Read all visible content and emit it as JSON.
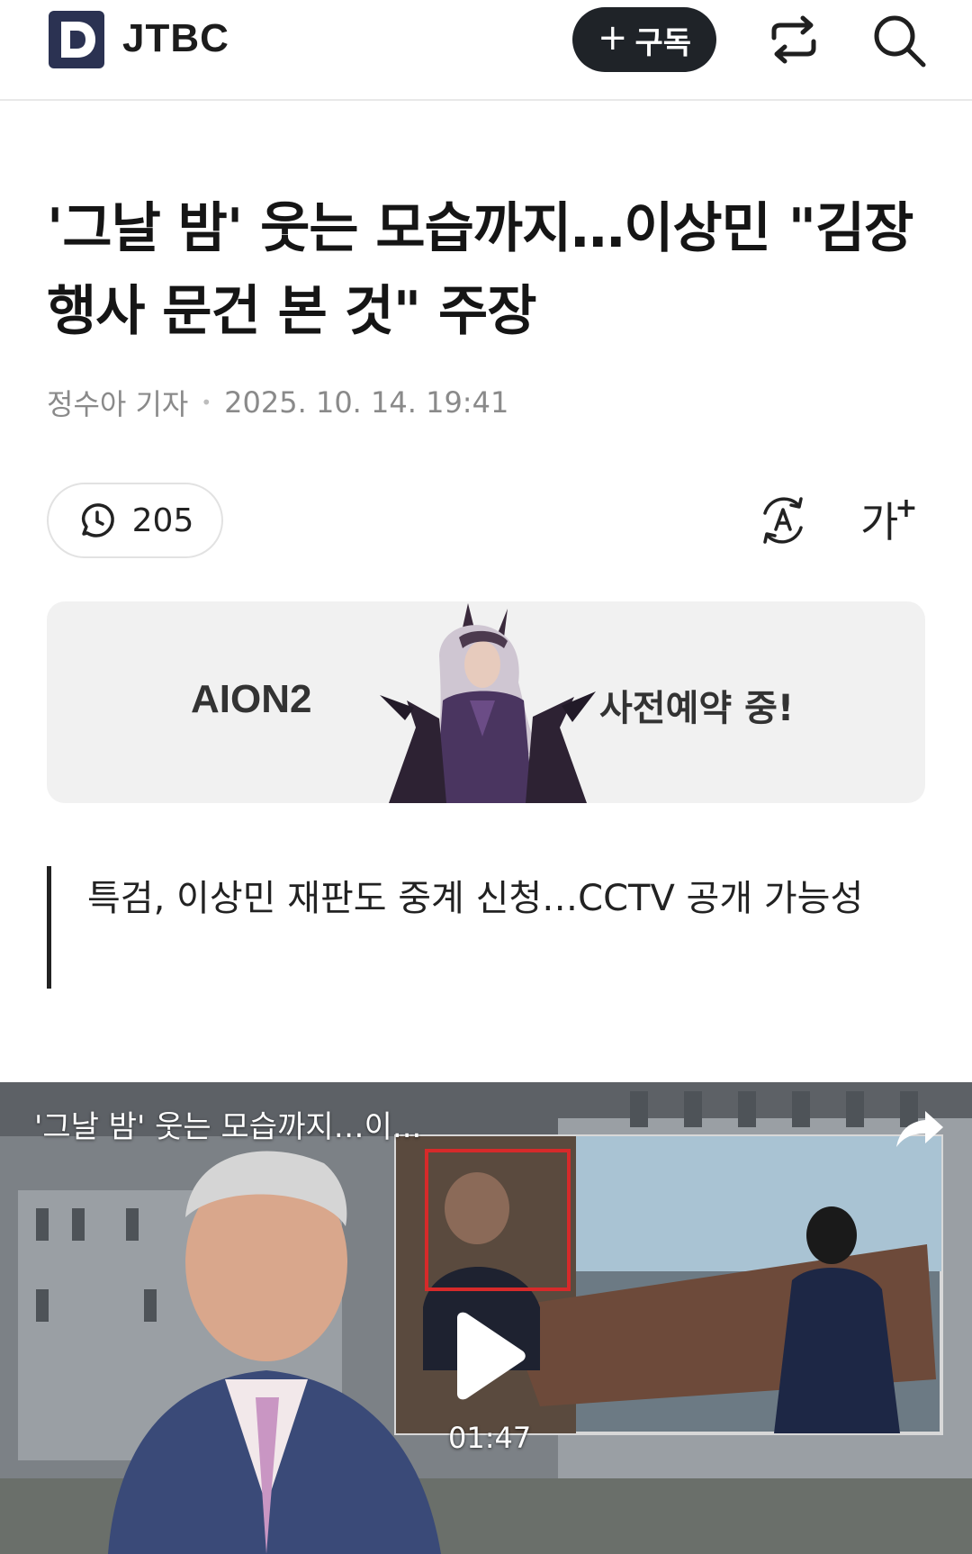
{
  "header": {
    "brand": "JTBC",
    "subscribe_label": "구독",
    "subscribe_icon": "plus-icon",
    "share_icon": "share-icon",
    "search_icon": "search-icon",
    "brand_color": "#2b3252"
  },
  "article": {
    "title": "'그날 밤' 웃는 모습까지…이상민 \"김장 행사 문건 본 것\" 주장",
    "reporter": "정수아 기자",
    "datetime": "2025. 10. 14. 19:41",
    "comment_count": "205",
    "translate_icon": "translate-icon",
    "font_size_label": "가",
    "font_size_plus": "+"
  },
  "ad": {
    "left_text": "AION2",
    "right_text": "사전예약 중!",
    "background": "#f1f1f1"
  },
  "quote": {
    "text": "특검, 이상민 재판도 중계 신청…CCTV 공개 가능성"
  },
  "video": {
    "title": "'그날 밤' 웃는 모습까지…이...",
    "duration": "01:47",
    "play_icon": "play-icon",
    "share_icon": "share-arrow-icon"
  }
}
